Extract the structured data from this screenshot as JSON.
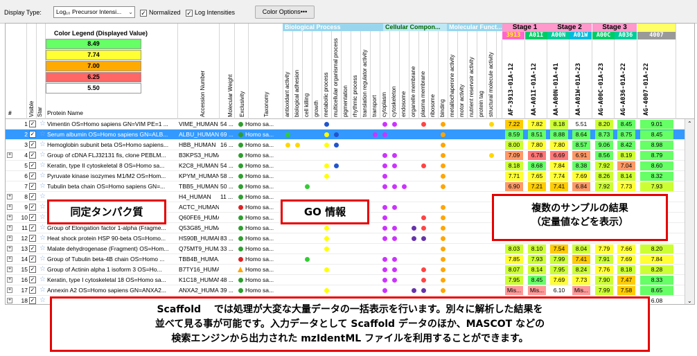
{
  "toolbar": {
    "display_type_label": "Display Type:",
    "display_type_value": "Log₁₀ Precursor Intensi...",
    "normalized_label": "Normalized",
    "log_label": "Log Intensities",
    "color_options_label": "Color Options•••"
  },
  "legend": {
    "title": "Color Legend (Displayed Value)",
    "items": [
      {
        "value": "8.49",
        "color": "#66ff66"
      },
      {
        "value": "7.74",
        "color": "#ffff33"
      },
      {
        "value": "7.00",
        "color": "#ffaa00"
      },
      {
        "value": "6.25",
        "color": "#ff6666"
      },
      {
        "value": "5.50",
        "color": "#ffffff"
      }
    ]
  },
  "columns": {
    "num": "#",
    "visible": "Visible",
    "star": "Star",
    "protein": "Protein Name",
    "accession": "Accession Number",
    "mw": "Molecular Weight",
    "excl": "Exclusivity",
    "tax": "Taxonomy"
  },
  "go_groups": [
    {
      "label": "Biological Process",
      "color": "#99d6ee"
    },
    {
      "label": "Cellular Compon...",
      "color": "#bfe8f5"
    },
    {
      "label": "Molecular Funct...",
      "color": "#99d6ee"
    }
  ],
  "go_terms": [
    "antioxidant activity",
    "biological adhesion",
    "cell killing",
    "growth",
    "metabolic process",
    "multicellular organismal process",
    "pigmentation",
    "rhythmic process",
    "translation regulator activity",
    "transport",
    "cytoplasm",
    "cytoskeleton",
    "endosome",
    "organelle membrane",
    "plasma membrane",
    "ribosome",
    "binding",
    "metallochaperone activity",
    "motor activity",
    "nutrient reservoir activity",
    "protein tag",
    "structural molecule activity"
  ],
  "stages": [
    {
      "label": "Stage 1",
      "samples": [
        "3913",
        "A01I"
      ]
    },
    {
      "label": "Stage 2",
      "samples": [
        "A00N",
        "A01W"
      ]
    },
    {
      "label": "Stage 3",
      "samples": [
        "A00C",
        "A036"
      ]
    },
    {
      "label": "",
      "samples": [
        "4007"
      ]
    }
  ],
  "quant_cols": [
    "AF-3913-01A-12",
    "AA-A01I-01A-12",
    "AA-A00N-01A-41",
    "AA-A01W-01A-23",
    "AG-A00C-01A-23",
    "AG-A036-01A-22",
    "AG-4007-01A-22"
  ],
  "rows": [
    {
      "n": "1",
      "name": "Vimentin OS=Homo sapiens GN=VIM PE=1 ...",
      "acc": "VIME_HUMAN",
      "mw": "54 ...",
      "excl": "green",
      "tax": "Homo sa...",
      "q": [
        "7.22",
        "7.82",
        "8.18",
        "5.51",
        "8.20",
        "8.45",
        "9.01"
      ]
    },
    {
      "n": "2",
      "name": "Serum albumin OS=Homo sapiens GN=ALB...",
      "acc": "ALBU_HUMAN",
      "mw": "69 ...",
      "excl": "green",
      "tax": "Homo sa...",
      "q": [
        "8.59",
        "8.51",
        "8.88",
        "8.64",
        "8.73",
        "8.75",
        "8.45"
      ]
    },
    {
      "n": "3",
      "name": "Hemoglobin subunit beta OS=Homo sapiens...",
      "acc": "HBB_HUMAN",
      "mw": "16 ...",
      "excl": "green",
      "tax": "Homo sa...",
      "q": [
        "8.00",
        "7.80",
        "7.80",
        "8.57",
        "9.06",
        "8.42",
        "8.98"
      ]
    },
    {
      "n": "4",
      "name": "Group of cDNA FLJ32131 fis, clone PEBLM...",
      "acc": "B3KPS3_HUMA...",
      "mw": "",
      "excl": "green",
      "tax": "Homo sa...",
      "q": [
        "7.09",
        "6.78",
        "6.69",
        "6.91",
        "8.56",
        "8.19",
        "8.79"
      ]
    },
    {
      "n": "5",
      "name": "Keratin, type II cytoskeletal 8 OS=Homo sa...",
      "acc": "K2C8_HUMAN",
      "mw": "54 ...",
      "excl": "green",
      "tax": "Homo sa...",
      "q": [
        "8.18",
        "8.68",
        "7.84",
        "8.38",
        "7.92",
        "7.04",
        "8.60"
      ]
    },
    {
      "n": "6",
      "name": "Pyruvate kinase isozymes M1/M2 OS=Hom...",
      "acc": "KPYM_HUMAN",
      "mw": "58 ...",
      "excl": "green",
      "tax": "Homo sa...",
      "q": [
        "7.71",
        "7.65",
        "7.74",
        "7.69",
        "8.26",
        "8.14",
        "8.32"
      ]
    },
    {
      "n": "7",
      "name": "Tubulin beta chain OS=Homo sapiens GN=...",
      "acc": "TBB5_HUMAN",
      "mw": "50 ...",
      "excl": "green",
      "tax": "Homo sa...",
      "q": [
        "6.90",
        "7.21",
        "7.41",
        "6.84",
        "7.92",
        "7.73",
        "7.93"
      ]
    },
    {
      "n": "8",
      "name": "",
      "acc": "H4_HUMAN",
      "mw": "11 ...",
      "excl": "green",
      "tax": "Homo sa...",
      "q": [
        "",
        "",
        "",
        "",
        "",
        "",
        ""
      ]
    },
    {
      "n": "9",
      "name": "",
      "acc": "ACTC_HUMAN",
      "mw": "",
      "excl": "red",
      "tax": "Homo sa...",
      "q": [
        "",
        "",
        "",
        "",
        "",
        "",
        ""
      ]
    },
    {
      "n": "10",
      "name": "",
      "acc": "Q60FE6_HUMA...",
      "mw": "",
      "excl": "green",
      "tax": "Homo sa...",
      "q": [
        "",
        "",
        "",
        "",
        "",
        "",
        ""
      ]
    },
    {
      "n": "11",
      "name": "Group of Elongation factor 1-alpha (Fragme...",
      "acc": "Q53G85_HUMA...",
      "mw": "",
      "excl": "green",
      "tax": "Homo sa...",
      "q": [
        "",
        "",
        "",
        "",
        "",
        "",
        ""
      ]
    },
    {
      "n": "12",
      "name": "Heat shock protein HSP 90-beta OS=Homo...",
      "acc": "HS90B_HUMAN",
      "mw": "83 ...",
      "excl": "green",
      "tax": "Homo sa...",
      "q": [
        "",
        "",
        "",
        "",
        "",
        "",
        ""
      ]
    },
    {
      "n": "13",
      "name": "Malate dehydrogenase (Fragment) OS=Hom...",
      "acc": "Q75MT9_HUMA...",
      "mw": "33 ...",
      "excl": "green",
      "tax": "Homo sa...",
      "q": [
        "8.03",
        "8.10",
        "7.54",
        "8.04",
        "7.79",
        "7.66",
        "8.20"
      ]
    },
    {
      "n": "14",
      "name": "Group of Tubulin beta-4B chain OS=Homo ...",
      "acc": "TBB4B_HUMA...",
      "mw": "",
      "excl": "red",
      "tax": "Homo sa...",
      "q": [
        "7.85",
        "7.93",
        "7.99",
        "7.41",
        "7.91",
        "7.69",
        "7.84"
      ]
    },
    {
      "n": "15",
      "name": "Group of Actinin alpha 1 isoform 3 OS=Ho...",
      "acc": "B7TY16_HUMA...",
      "mw": "",
      "excl": "orange",
      "tax": "Homo sa...",
      "q": [
        "8.07",
        "8.14",
        "7.95",
        "8.24",
        "7.76",
        "8.18",
        "8.28"
      ]
    },
    {
      "n": "16",
      "name": "Keratin, type I cytoskeletal 18 OS=Homo sa...",
      "acc": "K1C18_HUMAN",
      "mw": "48 ...",
      "excl": "green",
      "tax": "Homo sa...",
      "q": [
        "7.95",
        "8.45",
        "7.69",
        "7.73",
        "7.90",
        "7.47",
        "8.33"
      ]
    },
    {
      "n": "17",
      "name": "Annexin A2 OS=Homo sapiens GN=ANXA2...",
      "acc": "ANXA2_HUMAN",
      "mw": "39 ...",
      "excl": "green",
      "tax": "Homo sa...",
      "q": [
        "Mis...",
        "Mis...",
        "6.10",
        "Mis...",
        "7.99",
        "7.58",
        "8.65"
      ]
    },
    {
      "n": "18",
      "name": "",
      "acc": "",
      "mw": "",
      "excl": "green",
      "tax": "",
      "q": [
        "",
        "",
        "",
        "",
        "",
        "",
        "6.08"
      ]
    }
  ],
  "annotations": {
    "protein": "同定タンパク質",
    "go": "GO 情報",
    "samples_line1": "複数のサンプルの結果",
    "samples_line2": "（定量値などを表示）",
    "note_line1": "Scaffold 　では処理が大変な大量データの一括表示を行います。別々に解析した結果を",
    "note_line2": "並べて見る事が可能です。入力データとして Scaffold データのほか、MASCOT などの",
    "note_line3": "検索エンジンから出力された mzIdentML ファイルを利用することができます。"
  }
}
